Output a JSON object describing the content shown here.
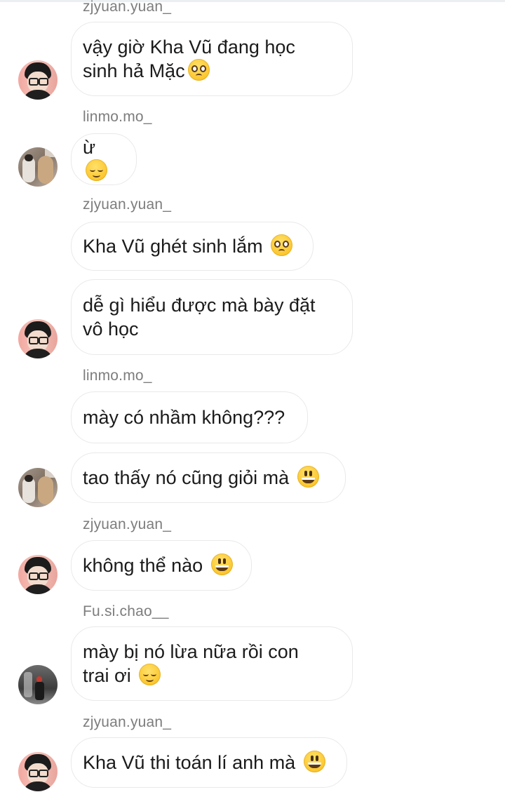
{
  "messages": [
    {
      "user": "zjyuan.yuan_",
      "text": "vậy giờ Kha Vũ đang học\nsinh hả Mặc",
      "emoji": "pleading-face-emoji"
    },
    {
      "user": "linmo.mo_",
      "text": "ừ",
      "emoji": "relieved-face-emoji"
    },
    {
      "user": "zjyuan.yuan_",
      "text": "Kha Vũ ghét sinh lắm",
      "emoji": "pleading-face-emoji"
    },
    {
      "user": "",
      "text": "dễ gì hiểu được mà bày đặt\nvô học",
      "emoji": ""
    },
    {
      "user": "linmo.mo_",
      "text": "mày có nhầm không???",
      "emoji": ""
    },
    {
      "user": "",
      "text": "tao thấy nó cũng giỏi mà",
      "emoji": "grinning-face-emoji"
    },
    {
      "user": "zjyuan.yuan_",
      "text": "không thể nào",
      "emoji": "grinning-face-emoji"
    },
    {
      "user": "Fu.si.chao__",
      "text": "mày bị nó lừa nữa rồi con\ntrai ơi",
      "emoji": "relieved-face-emoji"
    },
    {
      "user": "zjyuan.yuan_",
      "text": "Kha Vũ thi toán lí anh mà",
      "emoji": "grinning-face-emoji"
    }
  ],
  "avatars": {
    "zjyuan": "avatar-zjyuan",
    "linmo": "avatar-linmo",
    "fusichao": "avatar-fusichao"
  },
  "colors": {
    "background": "#ffffff",
    "username": "#7d7d7d",
    "bubble_border": "#e9e9e9",
    "text": "#1b1b1b"
  }
}
